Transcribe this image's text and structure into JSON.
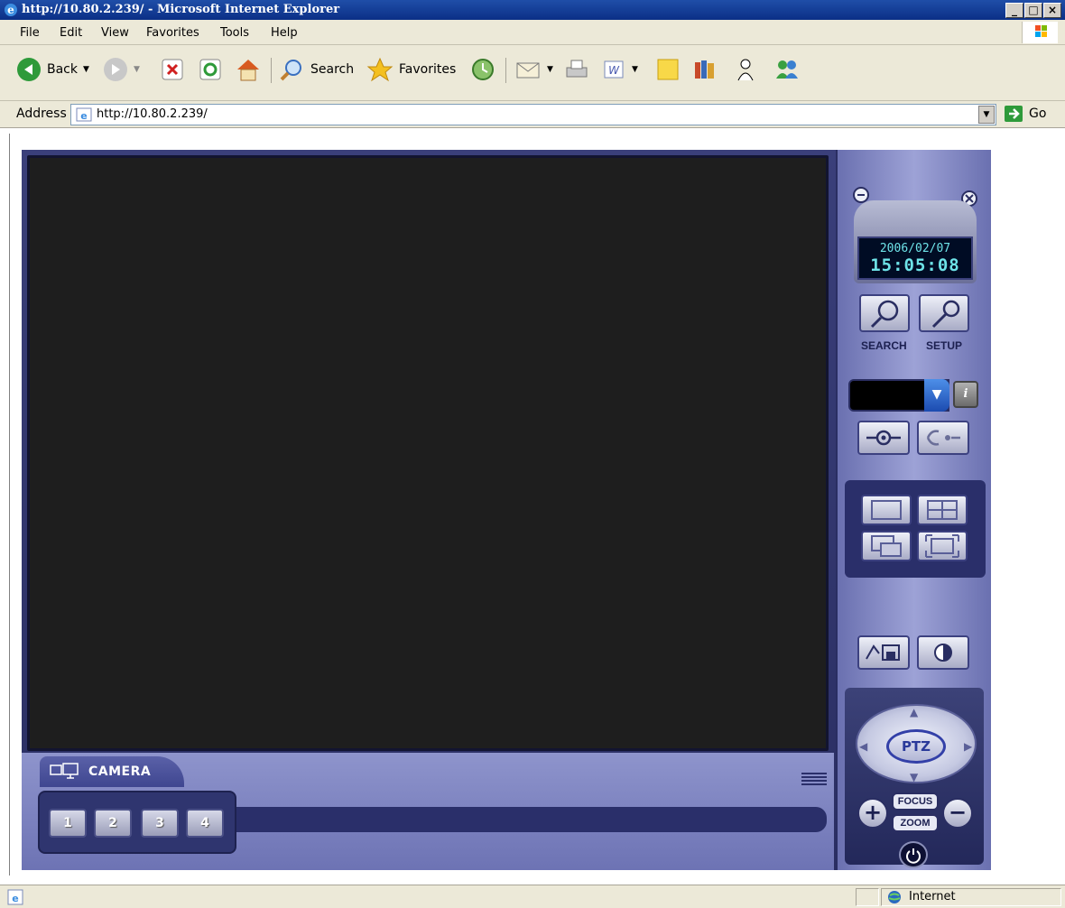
{
  "window": {
    "title": "http://10.80.2.239/ - Microsoft Internet Explorer",
    "minimize": "_",
    "restore": "□",
    "close": "×"
  },
  "menu": [
    "File",
    "Edit",
    "View",
    "Favorites",
    "Tools",
    "Help"
  ],
  "toolbar": {
    "back": "Back",
    "search": "Search",
    "favorites": "Favorites"
  },
  "address": {
    "label": "Address",
    "url": "http://10.80.2.239/",
    "go": "Go"
  },
  "viewer": {
    "camera_tab": "CAMERA",
    "cameras": [
      "1",
      "2",
      "3",
      "4"
    ],
    "date": "2006/02/07",
    "time": "15:05:08",
    "search_label": "SEARCH",
    "setup_label": "SETUP",
    "ptz_label": "PTZ",
    "focus_label": "FOCUS",
    "zoom_label": "ZOOM",
    "info_icon": "i"
  },
  "status": {
    "zone": "Internet"
  },
  "colors": {
    "ie_title": "#0b2f86",
    "chrome": "#ece9d8",
    "video": "#1e1e1e",
    "panel": "#6a70b0",
    "clock_text": "#6ee3e8"
  }
}
